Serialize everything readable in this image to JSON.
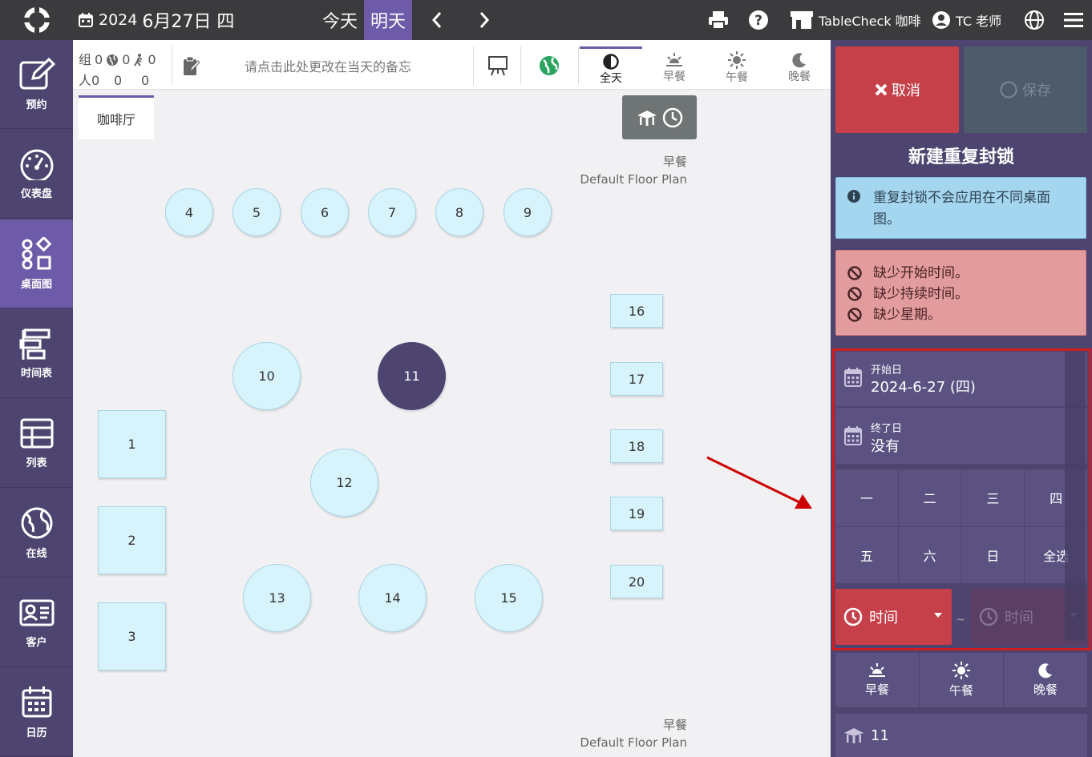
{
  "topbar": {
    "date_year": "2024",
    "date_text": "6月27日 四",
    "today_label": "今天",
    "tomorrow_label": "明天",
    "store_name": "TableCheck 咖啡",
    "user_name": "TC 老师"
  },
  "leftnav": {
    "items": [
      {
        "label": "预约",
        "icon": "edit-icon"
      },
      {
        "label": "仪表盘",
        "icon": "gauge-icon"
      },
      {
        "label": "桌面图",
        "icon": "shapes-icon"
      },
      {
        "label": "时间表",
        "icon": "timeline-icon"
      },
      {
        "label": "列表",
        "icon": "table-icon"
      },
      {
        "label": "在线",
        "icon": "globe-icon"
      },
      {
        "label": "客户",
        "icon": "id-card-icon"
      },
      {
        "label": "日历",
        "icon": "calendar-icon"
      }
    ],
    "active_index": 2
  },
  "strip": {
    "group_label": "组",
    "people_label": "人",
    "counts_row1": [
      "0",
      "0",
      "0"
    ],
    "counts_row2": [
      "0",
      "0",
      "0"
    ],
    "memo_placeholder": "请点击此处更改在当天的备忘",
    "meals": [
      {
        "label": "全天",
        "icon": "half-circle-icon",
        "active": true
      },
      {
        "label": "早餐",
        "icon": "sunrise-icon",
        "active": false
      },
      {
        "label": "午餐",
        "icon": "sun-icon",
        "active": false
      },
      {
        "label": "晚餐",
        "icon": "moon-icon",
        "active": false
      }
    ]
  },
  "floor": {
    "tab_label": "咖啡厅",
    "plan_top": {
      "meal": "早餐",
      "plan": "Default Floor Plan"
    },
    "plan_bottom": {
      "meal": "早餐",
      "plan": "Default Floor Plan"
    },
    "tables": [
      {
        "id": "4",
        "shape": "round"
      },
      {
        "id": "5",
        "shape": "round"
      },
      {
        "id": "6",
        "shape": "round"
      },
      {
        "id": "7",
        "shape": "round"
      },
      {
        "id": "8",
        "shape": "round"
      },
      {
        "id": "9",
        "shape": "round"
      },
      {
        "id": "10",
        "shape": "round"
      },
      {
        "id": "11",
        "shape": "round",
        "selected": true
      },
      {
        "id": "12",
        "shape": "round"
      },
      {
        "id": "13",
        "shape": "round"
      },
      {
        "id": "14",
        "shape": "round"
      },
      {
        "id": "15",
        "shape": "round"
      },
      {
        "id": "1",
        "shape": "square"
      },
      {
        "id": "2",
        "shape": "square"
      },
      {
        "id": "3",
        "shape": "square"
      },
      {
        "id": "16",
        "shape": "square"
      },
      {
        "id": "17",
        "shape": "square"
      },
      {
        "id": "18",
        "shape": "square"
      },
      {
        "id": "19",
        "shape": "square"
      },
      {
        "id": "20",
        "shape": "square"
      }
    ]
  },
  "panel": {
    "cancel_label": "取消",
    "save_label": "保存",
    "title": "新建重复封锁",
    "info_text": "重复封锁不会应用在不同桌面图。",
    "errors": [
      "缺少开始时间。",
      "缺少持续时间。",
      "缺少星期。"
    ],
    "start_date_label": "开始日",
    "start_date_value": "2024-6-27 (四)",
    "end_date_label": "终了日",
    "end_date_value": "没有",
    "days": [
      "一",
      "二",
      "三",
      "四",
      "五",
      "六",
      "日",
      "全选"
    ],
    "time_from_label": "时间",
    "time_sep": "~",
    "time_to_label": "时间",
    "meals": [
      "早餐",
      "午餐",
      "晚餐"
    ],
    "table_value": "11"
  },
  "colors": {
    "accent": "#6d5aa8",
    "nav_bg": "#4e4470",
    "danger": "#c6404a",
    "highlight": "#d01c1c"
  }
}
